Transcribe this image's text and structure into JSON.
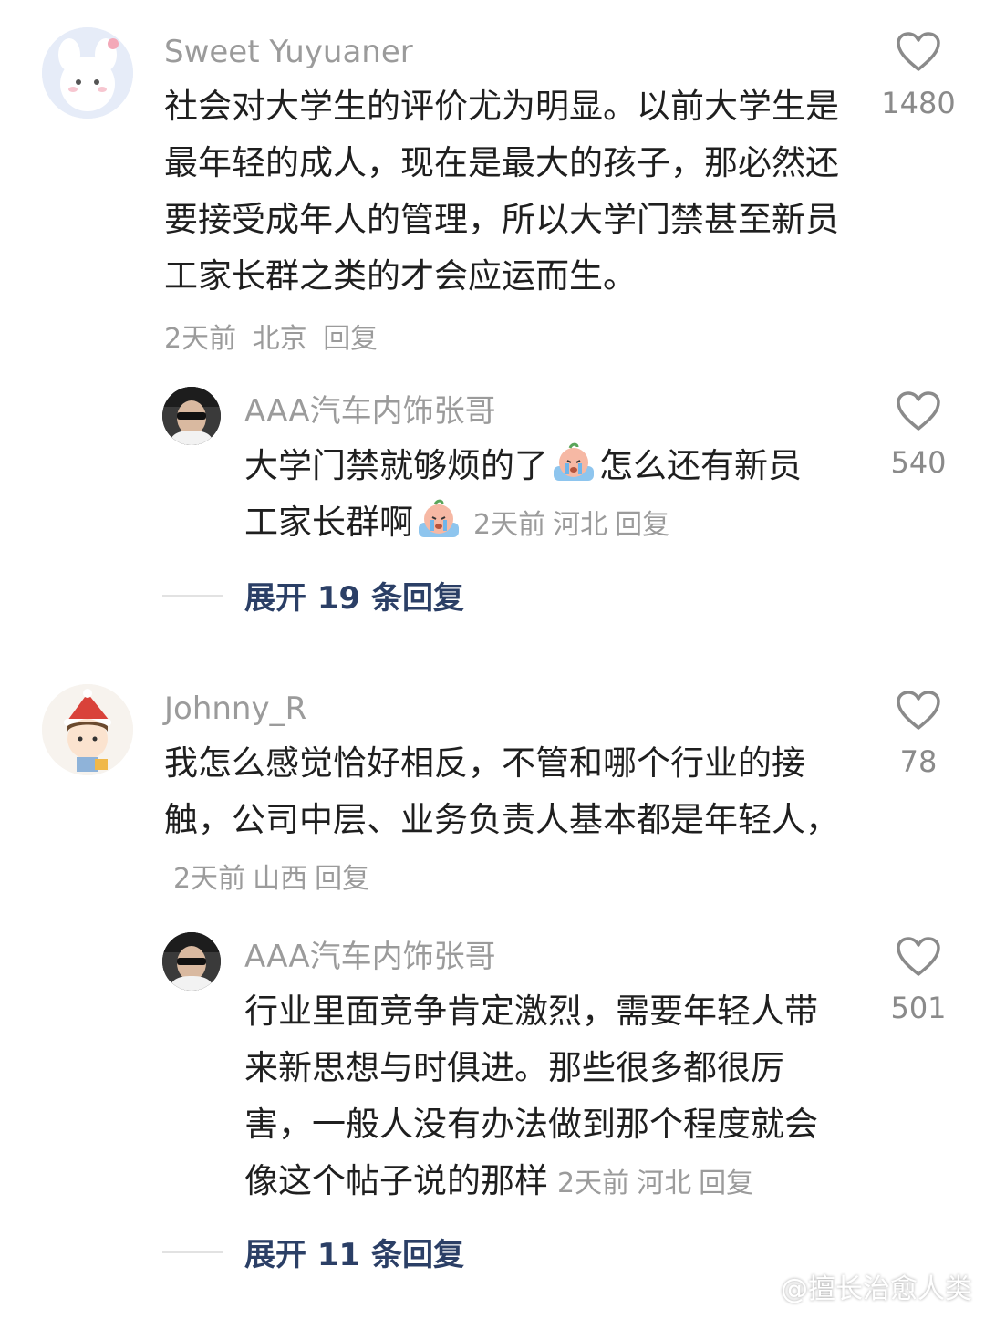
{
  "comments": [
    {
      "username": "Sweet Yuyuaner",
      "text": "社会对大学生的评价尤为明显。以前大学生是最年轻的成人，现在是最大的孩子，那必然还要接受成年人的管理，所以大学门禁甚至新员工家长群之类的才会应运而生。",
      "time": "2天前",
      "location": "北京",
      "reply_label": "回复",
      "likes": "1480",
      "reply": {
        "username": "AAA汽车内饰张哥",
        "text_part1": "大学门禁就够烦的了",
        "text_part2": "怎么还有新员工家长群啊",
        "time": "2天前",
        "location": "河北",
        "reply_label": "回复",
        "likes": "540"
      },
      "expand_label": "展开 19 条回复"
    },
    {
      "username": "Johnny_R",
      "text": "我怎么感觉恰好相反，不管和哪个行业的接触，公司中层、业务负责人基本都是年轻人，",
      "time": "2天前",
      "location": "山西",
      "reply_label": "回复",
      "likes": "78",
      "reply": {
        "username": "AAA汽车内饰张哥",
        "text": "行业里面竞争肯定激烈，需要年轻人带来新思想与时俱进。那些很多都很厉害，一般人没有办法做到那个程度就会像这个帖子说的那样",
        "time": "2天前",
        "location": "河北",
        "reply_label": "回复",
        "likes": "501"
      },
      "expand_label": "展开 11 条回复"
    }
  ],
  "watermark": "@擅长治愈人类",
  "watermark_icon": "weibo-logo-icon",
  "colors": {
    "username": "#9b9b9b",
    "text": "#1f1f1f",
    "meta": "#9b9b9b",
    "expand": "#2b3f66"
  }
}
